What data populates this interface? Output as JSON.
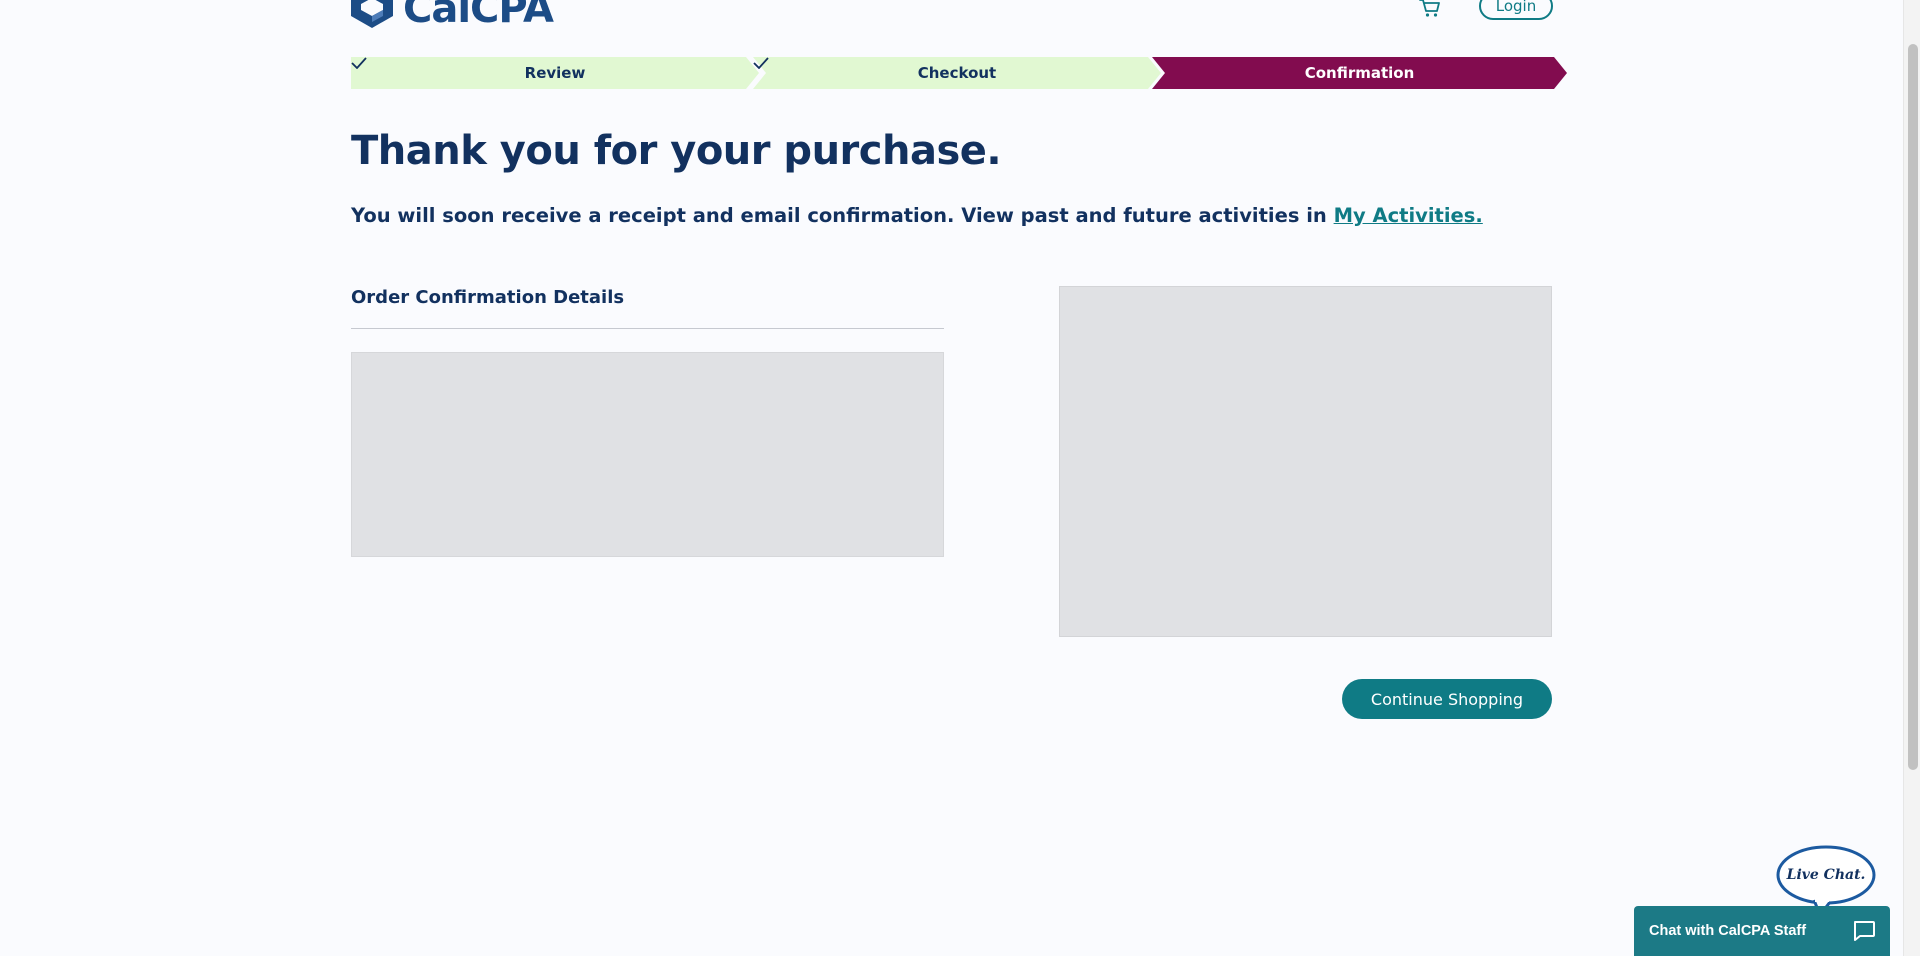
{
  "header": {
    "logo_text": "CalCPA",
    "login_label": "Login"
  },
  "stepper": {
    "steps": [
      {
        "label": "Review",
        "state": "completed"
      },
      {
        "label": "Checkout",
        "state": "completed"
      },
      {
        "label": "Confirmation",
        "state": "active"
      }
    ]
  },
  "main": {
    "title": "Thank you for your purchase.",
    "subtitle_text": "You will soon receive a receipt and email confirmation. View past and future activities in ",
    "subtitle_link": "My Activities.",
    "order_heading": "Order Confirmation Details",
    "continue_label": "Continue Shopping"
  },
  "chat": {
    "bubble_label": "Live Chat.",
    "bar_label": "Chat with CalCPA Staff"
  },
  "colors": {
    "brand_navy": "#12315f",
    "teal": "#0f7b85",
    "step_completed_bg": "#e1f8d2",
    "step_active_bg": "#820c4f"
  }
}
